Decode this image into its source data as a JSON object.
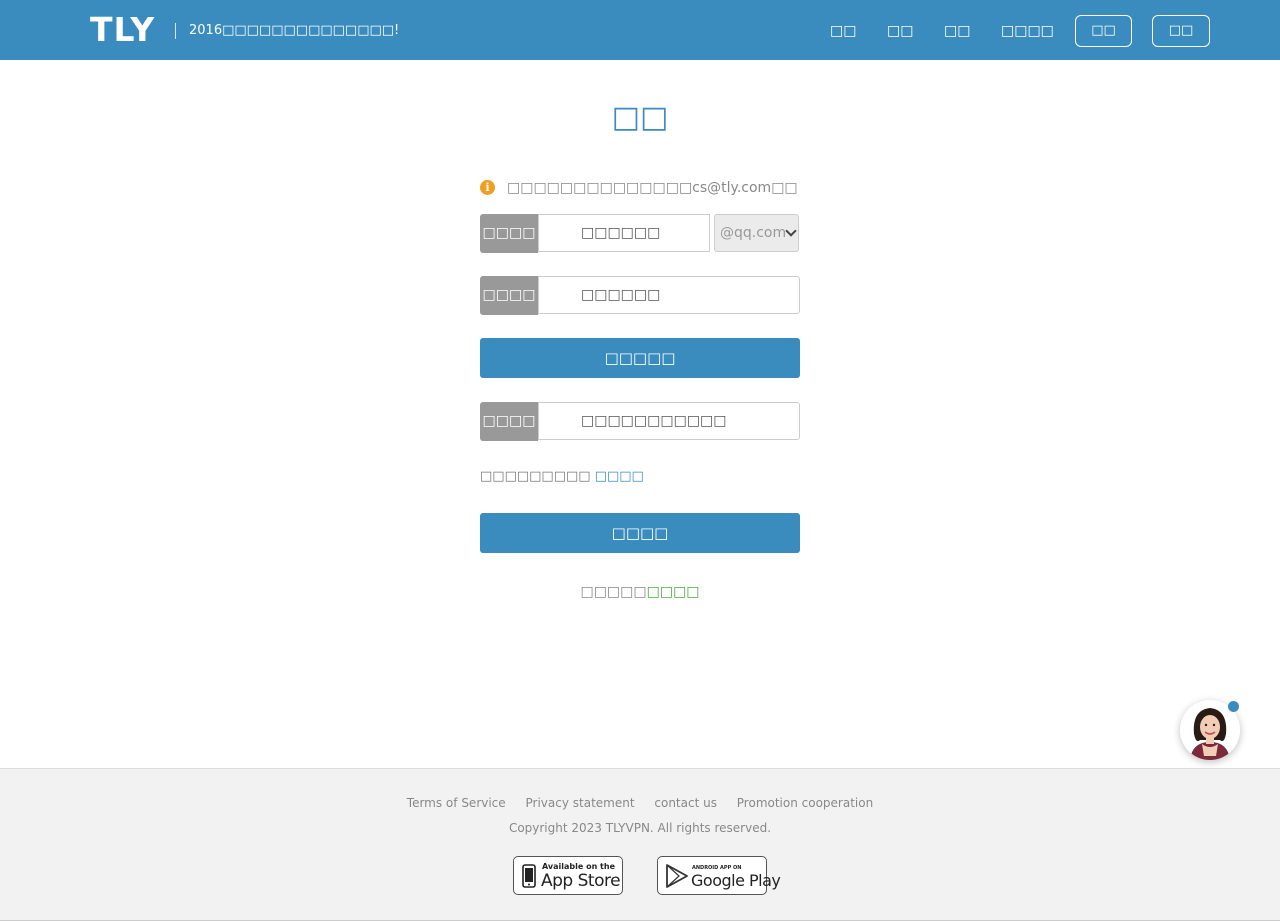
{
  "header": {
    "logo": "TLY",
    "tagline": "2016□□□□□□□□□□□□□□!",
    "nav": [
      "□□",
      "□□",
      "□□",
      "□□□□"
    ],
    "login_label": "□□",
    "register_label": "□□",
    "bg_color": "#3a8cbf"
  },
  "main": {
    "title": "□□",
    "notice": "□□□□□□□□□□□□□□cs@tly.com□□",
    "notice_icon": "info-icon",
    "email_row": {
      "label": "□□□□",
      "value": "□□□□□□",
      "domain": "@qq.com"
    },
    "code_row": {
      "label": "□□□□",
      "value": "□□□□□□"
    },
    "send_code_label": "□□□□□",
    "password_row": {
      "label": "□□□□",
      "value": "□□□□□□□□□□□"
    },
    "hint_text": "□□□□□□□□□",
    "hint_link": "□□□□",
    "submit_label": "□□□□",
    "bottom_text": "□□□□□",
    "bottom_link": "□□□□"
  },
  "footer": {
    "links": [
      "Terms of Service",
      "Privacy statement",
      "contact us",
      "Promotion cooperation"
    ],
    "copyright": "Copyright 2023 TLYVPN. All rights reserved.",
    "app_store": {
      "small": "Available on the",
      "big": "App Store"
    },
    "google_play": {
      "small": "ANDROID APP ON",
      "big": "Google Play"
    }
  },
  "colors": {
    "accent": "#3a8cbf",
    "warning": "#f0a020",
    "green": "#4bab3c"
  }
}
